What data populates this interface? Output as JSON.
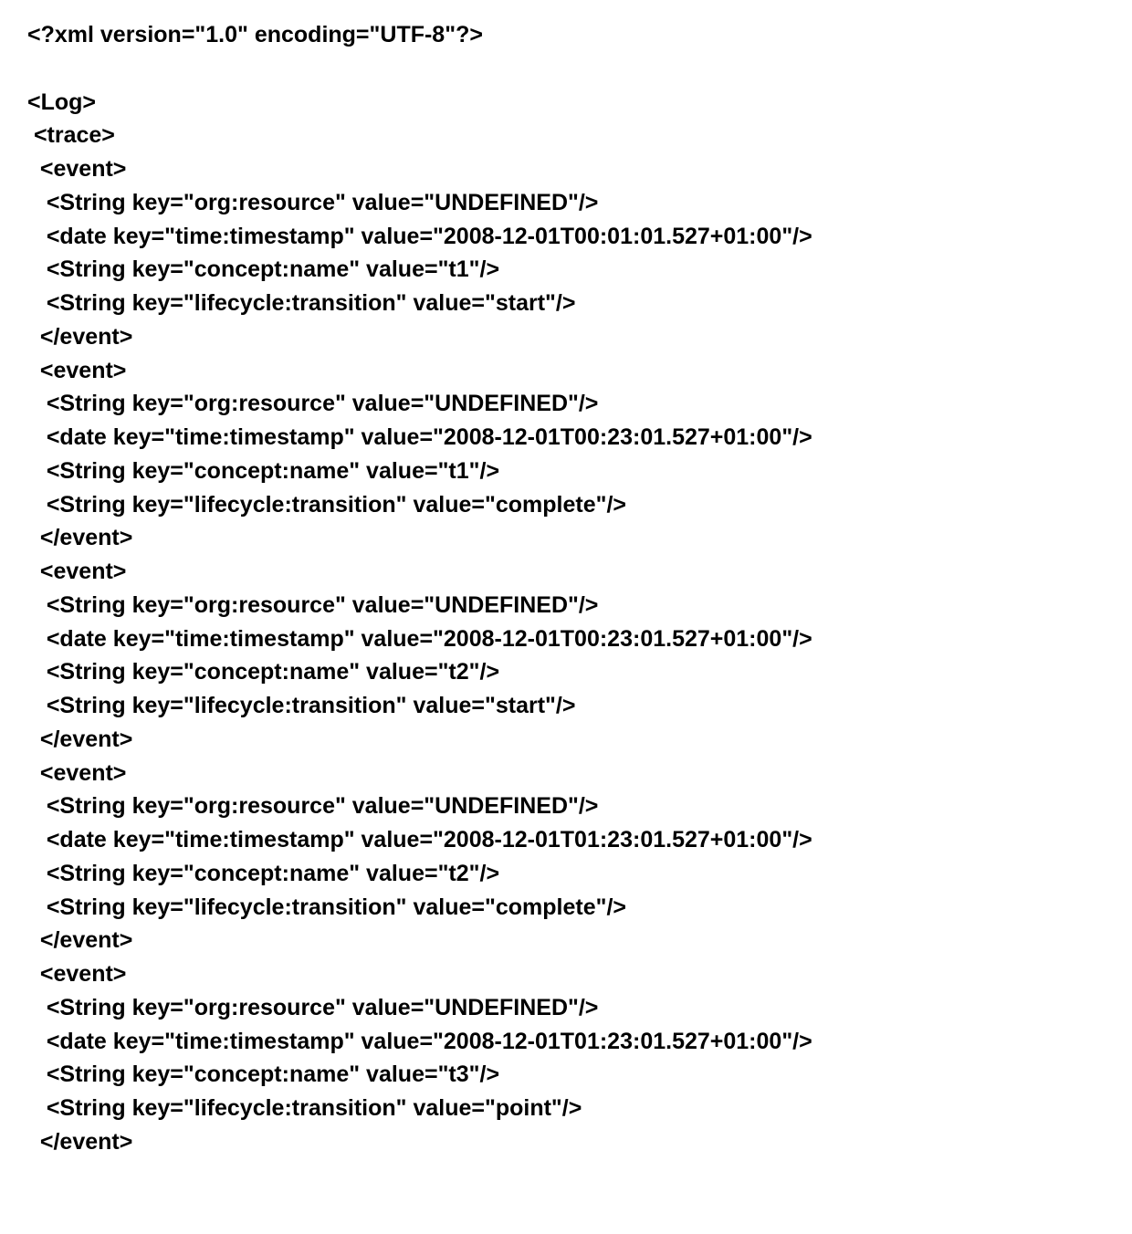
{
  "prolog": "<?xml version=\"1.0\" encoding=\"UTF-8\"?>",
  "root_open": "<Log>",
  "trace_open": " <trace>",
  "events": [
    {
      "open": "  <event>",
      "attrs": [
        {
          "tag": "String",
          "key": "org:resource",
          "value": "UNDEFINED"
        },
        {
          "tag": "date",
          "key": "time:timestamp",
          "value": "2008-12-01T00:01:01.527+01:00"
        },
        {
          "tag": "String",
          "key": "concept:name",
          "value": "t1"
        },
        {
          "tag": "String",
          "key": "lifecycle:transition",
          "value": "start"
        }
      ],
      "close": "  </event>"
    },
    {
      "open": "  <event>",
      "attrs": [
        {
          "tag": "String",
          "key": "org:resource",
          "value": "UNDEFINED"
        },
        {
          "tag": "date",
          "key": "time:timestamp",
          "value": "2008-12-01T00:23:01.527+01:00"
        },
        {
          "tag": "String",
          "key": "concept:name",
          "value": "t1"
        },
        {
          "tag": "String",
          "key": "lifecycle:transition",
          "value": "complete"
        }
      ],
      "close": "  </event>"
    },
    {
      "open": "  <event>",
      "attrs": [
        {
          "tag": "String",
          "key": "org:resource",
          "value": "UNDEFINED"
        },
        {
          "tag": "date",
          "key": "time:timestamp",
          "value": "2008-12-01T00:23:01.527+01:00"
        },
        {
          "tag": "String",
          "key": "concept:name",
          "value": "t2"
        },
        {
          "tag": "String",
          "key": "lifecycle:transition",
          "value": "start"
        }
      ],
      "close": "  </event>"
    },
    {
      "open": "  <event>",
      "attrs": [
        {
          "tag": "String",
          "key": "org:resource",
          "value": "UNDEFINED"
        },
        {
          "tag": "date",
          "key": "time:timestamp",
          "value": "2008-12-01T01:23:01.527+01:00"
        },
        {
          "tag": "String",
          "key": "concept:name",
          "value": "t2"
        },
        {
          "tag": "String",
          "key": "lifecycle:transition",
          "value": "complete"
        }
      ],
      "close": "  </event>"
    },
    {
      "open": "  <event>",
      "attrs": [
        {
          "tag": "String",
          "key": "org:resource",
          "value": "UNDEFINED"
        },
        {
          "tag": "date",
          "key": "time:timestamp",
          "value": "2008-12-01T01:23:01.527+01:00"
        },
        {
          "tag": "String",
          "key": "concept:name",
          "value": "t3"
        },
        {
          "tag": "String",
          "key": "lifecycle:transition",
          "value": "point"
        }
      ],
      "close": "  </event>"
    }
  ]
}
